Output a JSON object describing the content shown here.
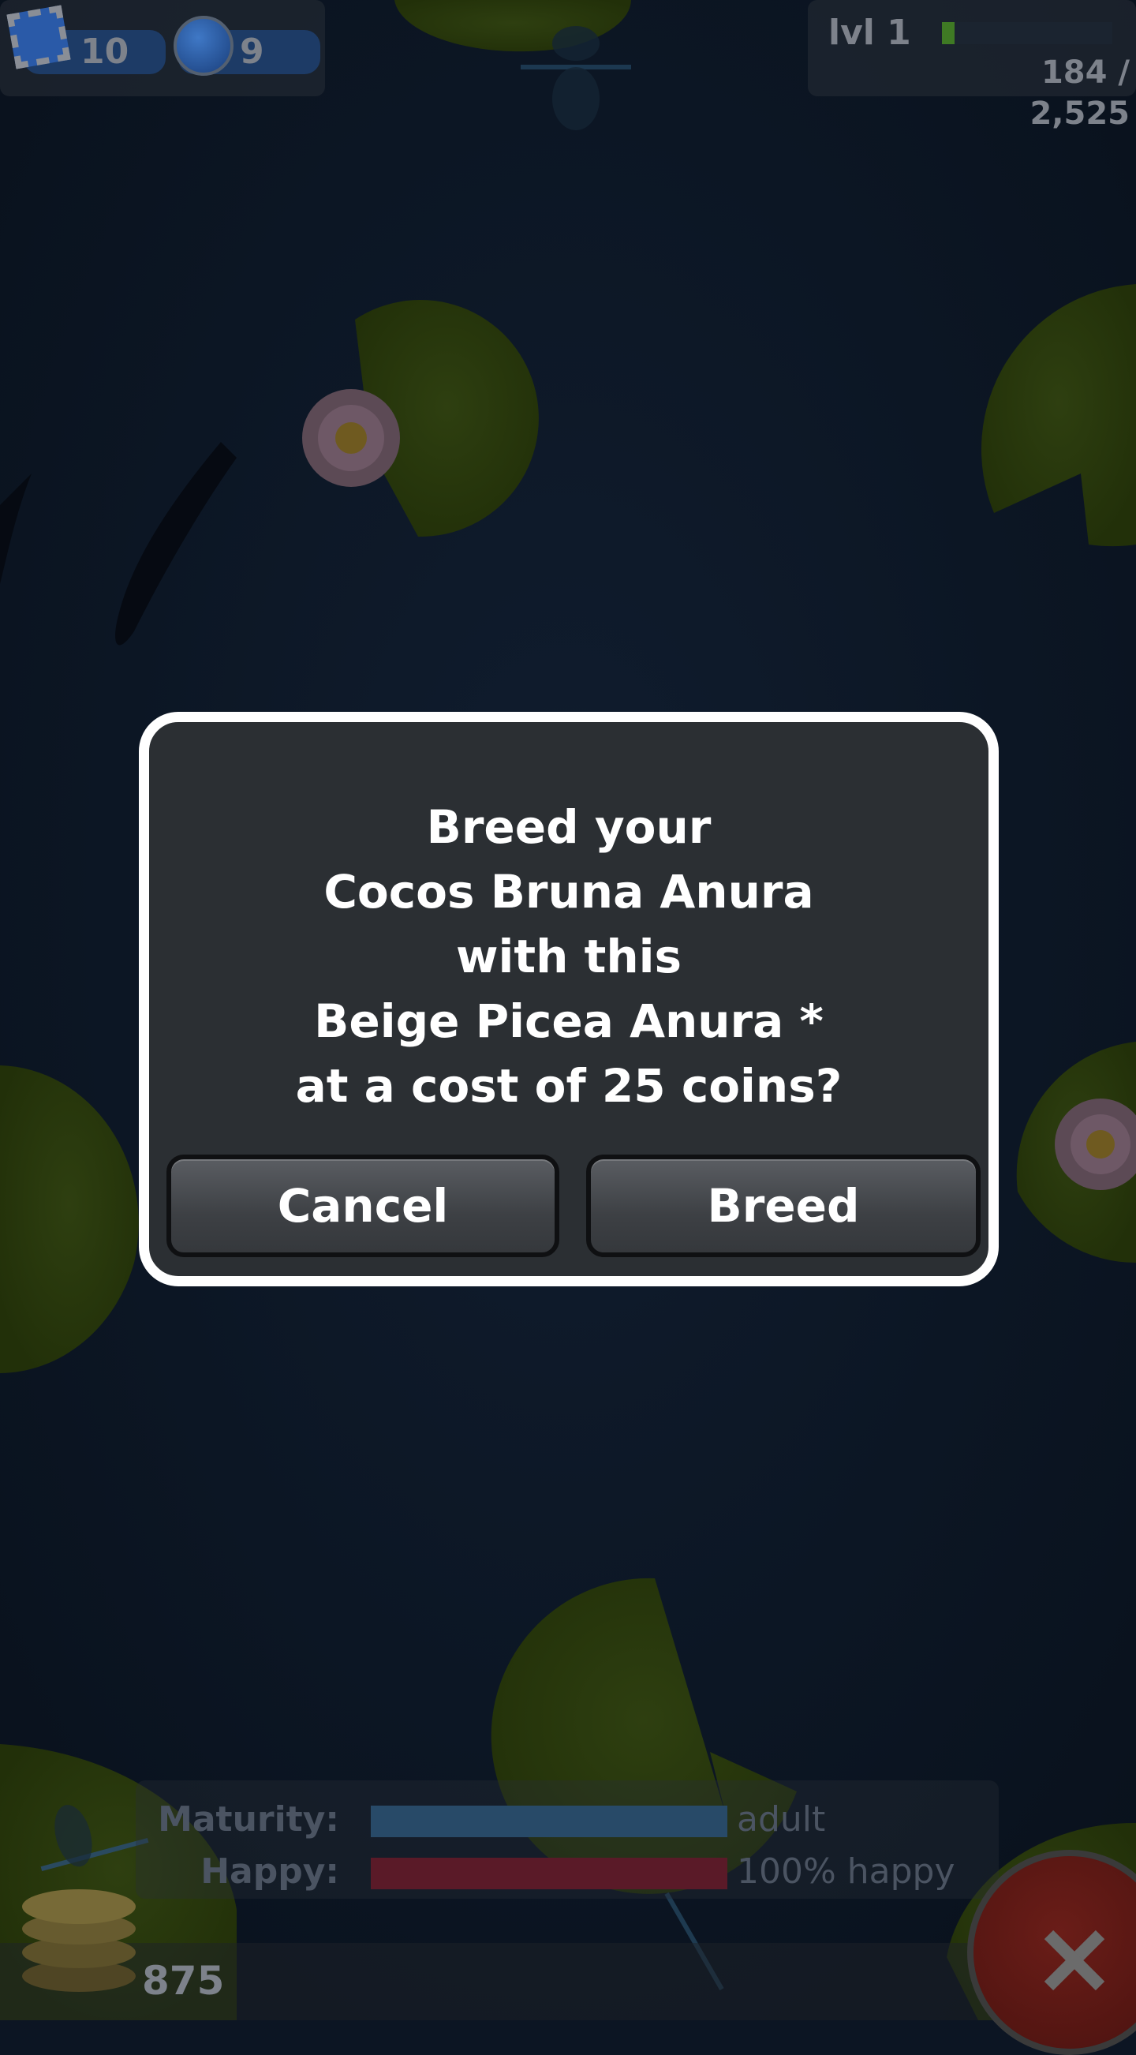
{
  "hud": {
    "stamps": "10",
    "gems": "9",
    "level": "lvl 1",
    "xp": "184 / 2,525",
    "xp_fraction": 0.073,
    "coins": "875"
  },
  "status": {
    "maturity_label": "Maturity:",
    "maturity_value": "adult",
    "maturity_fraction": 1.0,
    "happy_label": "Happy:",
    "happy_value": "100% happy",
    "happy_fraction": 1.0
  },
  "dialog": {
    "line1": "Breed your",
    "line2": "Cocos Bruna Anura",
    "line3": "with this",
    "line4": "Beige Picea Anura *",
    "line5": "at a cost of 25 coins?",
    "cancel_label": "Cancel",
    "breed_label": "Breed"
  },
  "colors": {
    "water": "#0c1523",
    "lily_pad": "#7fb91d",
    "dialog_bg": "#2b2f33",
    "dialog_border": "#ffffff",
    "maturity_bar": "#3a86c8",
    "happy_bar": "#c0213c",
    "xp_bar": "#4a9a2c",
    "close_button": "#c8281e"
  }
}
